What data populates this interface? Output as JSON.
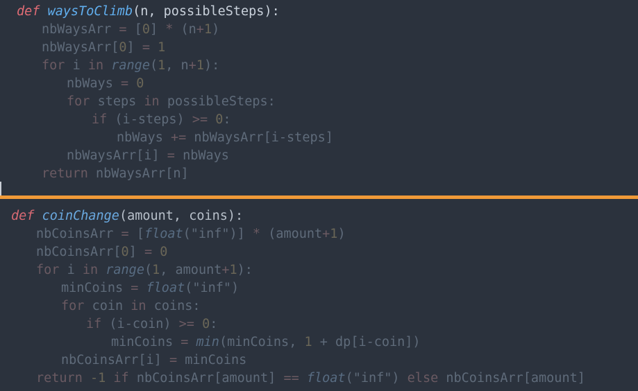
{
  "panels": {
    "top": {
      "lines": [
        [
          {
            "t": "def",
            "c": "kw"
          },
          {
            "t": " ",
            "c": "txt"
          },
          {
            "t": "waysToClimb",
            "c": "fn"
          },
          {
            "t": "(n, possibleSteps):",
            "c": "txt"
          }
        ],
        [
          {
            "t": "nbWaysArr ",
            "c": "txt"
          },
          {
            "t": "= ",
            "c": "op"
          },
          {
            "t": "[",
            "c": "txt"
          },
          {
            "t": "0",
            "c": "num"
          },
          {
            "t": "] ",
            "c": "txt"
          },
          {
            "t": "* ",
            "c": "op"
          },
          {
            "t": "(n",
            "c": "txt"
          },
          {
            "t": "+",
            "c": "op"
          },
          {
            "t": "1",
            "c": "num"
          },
          {
            "t": ")",
            "c": "txt"
          }
        ],
        [
          {
            "t": "nbWaysArr[",
            "c": "txt"
          },
          {
            "t": "0",
            "c": "num"
          },
          {
            "t": "] ",
            "c": "txt"
          },
          {
            "t": "= ",
            "c": "op"
          },
          {
            "t": "1",
            "c": "num"
          }
        ],
        [
          {
            "t": "for ",
            "c": "kw"
          },
          {
            "t": "i ",
            "c": "txt"
          },
          {
            "t": "in ",
            "c": "kw"
          },
          {
            "t": "range",
            "c": "fn"
          },
          {
            "t": "(",
            "c": "txt"
          },
          {
            "t": "1",
            "c": "num"
          },
          {
            "t": ", n",
            "c": "txt"
          },
          {
            "t": "+",
            "c": "op"
          },
          {
            "t": "1",
            "c": "num"
          },
          {
            "t": "):",
            "c": "txt"
          }
        ],
        [
          {
            "t": "nbWays ",
            "c": "txt"
          },
          {
            "t": "= ",
            "c": "op"
          },
          {
            "t": "0",
            "c": "num"
          }
        ],
        [
          {
            "t": "for ",
            "c": "kw"
          },
          {
            "t": "steps ",
            "c": "txt"
          },
          {
            "t": "in ",
            "c": "kw"
          },
          {
            "t": "possibleSteps:",
            "c": "txt"
          }
        ],
        [
          {
            "t": "if ",
            "c": "kw"
          },
          {
            "t": "(i-steps) ",
            "c": "txt"
          },
          {
            "t": ">= ",
            "c": "op"
          },
          {
            "t": "0",
            "c": "num"
          },
          {
            "t": ":",
            "c": "txt"
          }
        ],
        [
          {
            "t": "nbWays ",
            "c": "txt"
          },
          {
            "t": "+= ",
            "c": "op"
          },
          {
            "t": "nbWaysArr[i-steps]",
            "c": "txt"
          }
        ],
        [
          {
            "t": "nbWaysArr[i] ",
            "c": "txt"
          },
          {
            "t": "= ",
            "c": "op"
          },
          {
            "t": "nbWays",
            "c": "txt"
          }
        ],
        [
          {
            "t": "return ",
            "c": "kw"
          },
          {
            "t": "nbWaysArr[n]",
            "c": "txt"
          }
        ]
      ]
    },
    "bottom": {
      "lines": [
        [
          {
            "t": "def",
            "c": "kw"
          },
          {
            "t": " ",
            "c": "txt"
          },
          {
            "t": "coinChange",
            "c": "fn"
          },
          {
            "t": "(amount, coins):",
            "c": "txt"
          }
        ],
        [
          {
            "t": "nbCoinsArr ",
            "c": "txt"
          },
          {
            "t": "= ",
            "c": "op"
          },
          {
            "t": "[",
            "c": "txt"
          },
          {
            "t": "float",
            "c": "fn"
          },
          {
            "t": "(\"inf\")] ",
            "c": "txt"
          },
          {
            "t": "* ",
            "c": "op"
          },
          {
            "t": "(amount",
            "c": "txt"
          },
          {
            "t": "+",
            "c": "op"
          },
          {
            "t": "1",
            "c": "num"
          },
          {
            "t": ")",
            "c": "txt"
          }
        ],
        [
          {
            "t": "nbCoinsArr[",
            "c": "txt"
          },
          {
            "t": "0",
            "c": "num"
          },
          {
            "t": "] ",
            "c": "txt"
          },
          {
            "t": "= ",
            "c": "op"
          },
          {
            "t": "0",
            "c": "num"
          }
        ],
        [
          {
            "t": "for ",
            "c": "kw"
          },
          {
            "t": "i ",
            "c": "txt"
          },
          {
            "t": "in ",
            "c": "kw"
          },
          {
            "t": "range",
            "c": "fn"
          },
          {
            "t": "(",
            "c": "txt"
          },
          {
            "t": "1",
            "c": "num"
          },
          {
            "t": ", amount",
            "c": "txt"
          },
          {
            "t": "+",
            "c": "op"
          },
          {
            "t": "1",
            "c": "num"
          },
          {
            "t": "):",
            "c": "txt"
          }
        ],
        [
          {
            "t": "minCoins ",
            "c": "txt"
          },
          {
            "t": "= ",
            "c": "op"
          },
          {
            "t": "float",
            "c": "fn"
          },
          {
            "t": "(\"inf\")",
            "c": "txt"
          }
        ],
        [
          {
            "t": "for ",
            "c": "kw"
          },
          {
            "t": "coin ",
            "c": "txt"
          },
          {
            "t": "in ",
            "c": "kw"
          },
          {
            "t": "coins:",
            "c": "txt"
          }
        ],
        [
          {
            "t": "if ",
            "c": "kw"
          },
          {
            "t": "(i-coin) ",
            "c": "txt"
          },
          {
            "t": ">= ",
            "c": "op"
          },
          {
            "t": "0",
            "c": "num"
          },
          {
            "t": ":",
            "c": "txt"
          }
        ],
        [
          {
            "t": "minCoins ",
            "c": "txt"
          },
          {
            "t": "= ",
            "c": "op"
          },
          {
            "t": "min",
            "c": "fn"
          },
          {
            "t": "(minCoins, ",
            "c": "txt"
          },
          {
            "t": "1",
            "c": "num"
          },
          {
            "t": " + dp[i-coin])",
            "c": "txt"
          }
        ],
        [
          {
            "t": "nbCoinsArr[i] ",
            "c": "txt"
          },
          {
            "t": "= ",
            "c": "op"
          },
          {
            "t": "minCoins",
            "c": "txt"
          }
        ],
        [
          {
            "t": "return ",
            "c": "kw"
          },
          {
            "t": "-1",
            "c": "num"
          },
          {
            "t": " ",
            "c": "txt"
          },
          {
            "t": "if ",
            "c": "kw"
          },
          {
            "t": "nbCoinsArr[amount] ",
            "c": "txt"
          },
          {
            "t": "== ",
            "c": "op"
          },
          {
            "t": "float",
            "c": "fn"
          },
          {
            "t": "(\"inf\") ",
            "c": "txt"
          },
          {
            "t": "else ",
            "c": "kw"
          },
          {
            "t": "nbCoinsArr[amount]",
            "c": "txt"
          }
        ]
      ]
    }
  },
  "colors": {
    "background": "#2b323d",
    "divider": "#f09a38",
    "keyword": "#e06c75",
    "function": "#61afef",
    "text": "#c9d1db",
    "dimmed_text": "#5f6b7a"
  }
}
